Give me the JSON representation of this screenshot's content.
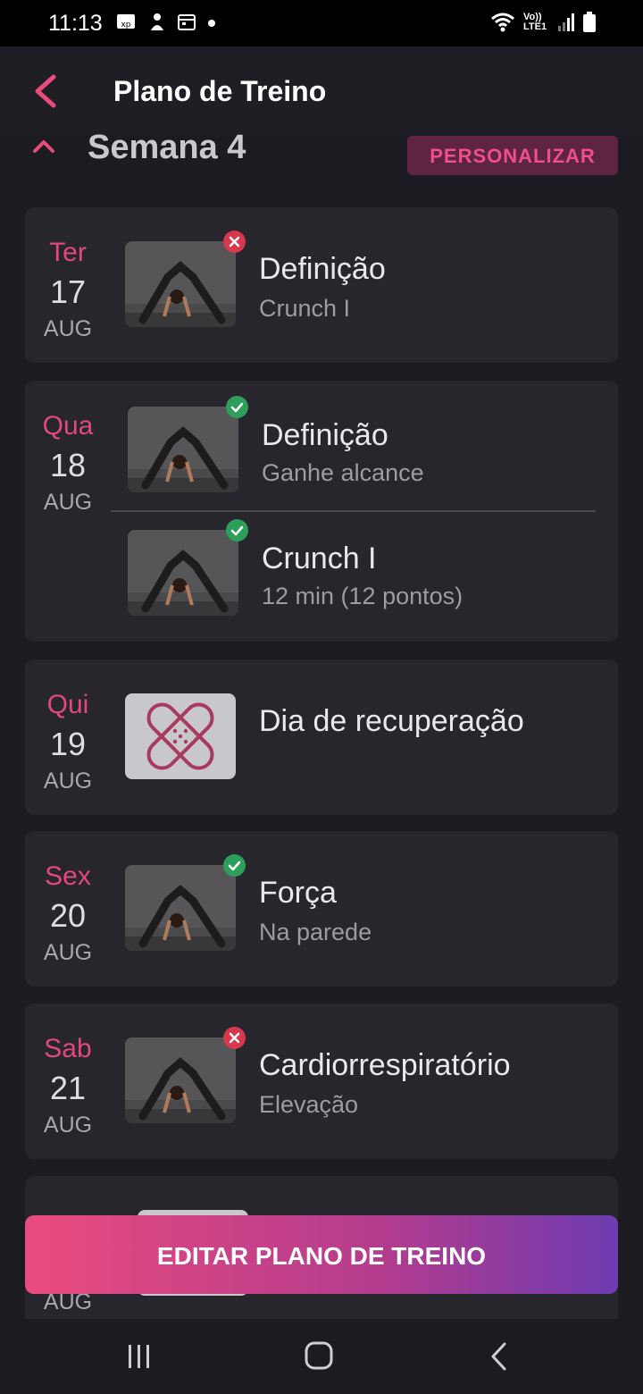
{
  "status_bar": {
    "time": "11:13",
    "network": "Vo)) LTE1"
  },
  "header": {
    "title": "Plano de Treino"
  },
  "week": {
    "title": "Semana 4",
    "customize_label": "PERSONALIZAR"
  },
  "days": [
    {
      "dow": "Ter",
      "day": "17",
      "month": "AUG",
      "workouts": [
        {
          "title": "Definição",
          "subtitle": "Crunch I",
          "status": "missed"
        }
      ]
    },
    {
      "dow": "Qua",
      "day": "18",
      "month": "AUG",
      "workouts": [
        {
          "title": "Definição",
          "subtitle": "Ganhe alcance",
          "status": "done"
        },
        {
          "title": "Crunch I",
          "subtitle": "12 min (12 pontos)",
          "status": "done"
        }
      ]
    },
    {
      "dow": "Qui",
      "day": "19",
      "month": "AUG",
      "workouts": [
        {
          "title": "Dia de recuperação",
          "subtitle": "",
          "status": "rest"
        }
      ]
    },
    {
      "dow": "Sex",
      "day": "20",
      "month": "AUG",
      "workouts": [
        {
          "title": "Força",
          "subtitle": "Na parede",
          "status": "done"
        }
      ]
    },
    {
      "dow": "Sab",
      "day": "21",
      "month": "AUG",
      "workouts": [
        {
          "title": "Cardiorrespiratório",
          "subtitle": "Elevação",
          "status": "missed"
        }
      ]
    },
    {
      "month": "AUG"
    }
  ],
  "footer": {
    "edit_label": "EDITAR PLANO DE TREINO"
  },
  "colors": {
    "accent": "#e0487e",
    "done": "#2e9e5b",
    "missed": "#d7384e",
    "card": "#27262c",
    "background": "#1c1b21"
  }
}
